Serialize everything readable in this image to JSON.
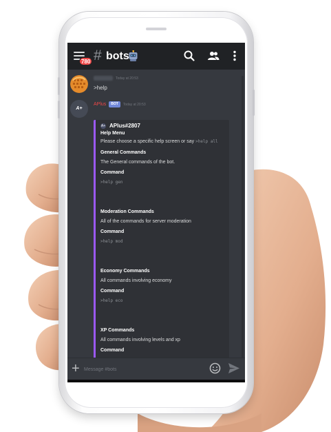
{
  "header": {
    "notification_count": "780",
    "hash": "#",
    "channel_name": "bots"
  },
  "messages": [
    {
      "author": "",
      "timestamp": "Today at 20:53",
      "text": ">help"
    },
    {
      "author": "APlus",
      "bot_tag": "BOT",
      "timestamp": "Today at 20:53",
      "avatar_text": "A+"
    }
  ],
  "embed": {
    "author_icon": "A+",
    "author_name": "APlus#2807",
    "title": "Help Menu",
    "description": "Please choose a specific help screen or say",
    "description_code": ">help all",
    "sections": [
      {
        "title": "General Commands",
        "text": "The General commands of the bot.",
        "command_label": "Command",
        "command": ">help gen"
      },
      {
        "title": "Moderation Commands",
        "text": "All of the commands for server moderation",
        "command_label": "Command",
        "command": ">help mod"
      },
      {
        "title": "Economy Commands",
        "text": "All commands involving economy",
        "command_label": "Command",
        "command": ">help eco"
      },
      {
        "title": "XP Commands",
        "text": "All commands involving levels and xp",
        "command_label": "Command"
      }
    ],
    "accent_color": "#9b59f5"
  },
  "composer": {
    "placeholder": "Message #bots"
  },
  "colors": {
    "background": "#36393f",
    "topbar": "#202225",
    "badge": "#f04747",
    "bot_tag": "#7289da"
  },
  "icons": [
    "hamburger-icon",
    "robot-icon",
    "search-icon",
    "members-icon",
    "more-icon",
    "plus-icon",
    "emoji-icon",
    "send-icon"
  ]
}
